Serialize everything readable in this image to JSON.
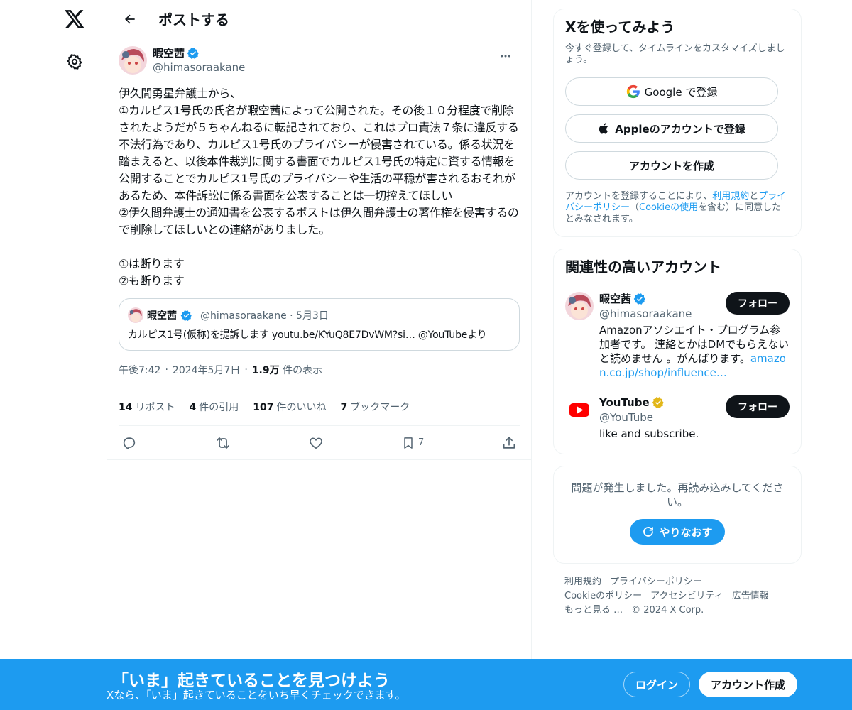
{
  "nav": {
    "logo_icon": "x-logo-icon",
    "settings_icon": "gear-icon"
  },
  "header": {
    "title": "ポストする"
  },
  "post": {
    "author_name": "暇空茜",
    "author_handle": "@himasoraakane",
    "body": "伊久間勇星弁護士から、\n①カルピス1号氏の氏名が暇空茜によって公開された。その後１０分程度で削除されたようだが５ちゃんねるに転記されており、これはプロ責法７条に違反する不法行為であり、カルピス1号氏のプライバシーが侵害されている。係る状況を踏まえると、以後本件裁判に関する書面でカルピス1号氏の特定に資する情報を公開することでカルピス1号氏のプライバシーや生活の平穏が害されるおそれがあるため、本件訴訟に係る書面を公表することは一切控えてほしい\n②伊久間弁護士の通知書を公表するポストは伊久間弁護士の著作権を侵害するので削除してほしいとの連絡がありました。\n\n①は断ります\n②も断ります",
    "quote": {
      "name": "暇空茜",
      "meta": "@himasoraakane · 5月3日",
      "text": "カルピス1号(仮称)を提訴します youtu.be/KYuQ8E7DvWM?si… @YouTubeより"
    },
    "time": "午後7:42",
    "date": "2024年5月7日",
    "views_count": "1.9万",
    "views_label": "件の表示",
    "stats": [
      {
        "count": "14",
        "label": "リポスト"
      },
      {
        "count": "4",
        "label": "件の引用"
      },
      {
        "count": "107",
        "label": "件のいいね"
      },
      {
        "count": "7",
        "label": "ブックマーク"
      }
    ],
    "bookmark_count": "7"
  },
  "signup_card": {
    "title": "Xを使ってみよう",
    "subtitle": "今すぐ登録して、タイムラインをカスタマイズしましょう。",
    "google_label": "Google で登録",
    "apple_label": "Appleのアカウントで登録",
    "create_label": "アカウントを作成",
    "legal_pre": "アカウントを登録することにより、",
    "legal_terms": "利用規約",
    "legal_and": "と",
    "legal_privacy": "プライバシーポリシー",
    "legal_mid": "（",
    "legal_cookie": "Cookieの使用",
    "legal_post": "を含む）に同意したとみなされます。"
  },
  "related": {
    "title": "関連性の高いアカウント",
    "follow_label": "フォロー",
    "accounts": [
      {
        "name": "暇空茜",
        "handle": "@himasoraakane",
        "bio": "Amazonアソシエイト・プログラム参加者です。 連絡とかはDMでもらえないと読めません 。がんばりま",
        "bio_tail": "す。",
        "bio_link": "amazon.co.jp/shop/influence…"
      },
      {
        "name": "YouTube",
        "handle": "@YouTube",
        "bio": "like and subscribe."
      }
    ]
  },
  "error_card": {
    "message": "問題が発生しました。再読み込みしてください。",
    "retry_label": "やりなおす"
  },
  "footer": {
    "links": [
      "利用規約",
      "プライバシーポリシー",
      "Cookieのポリシー",
      "アクセシビリティ",
      "広告情報",
      "もっと見る …",
      "© 2024 X Corp."
    ]
  },
  "banner": {
    "title": "「いま」起きていることを見つけよう",
    "subtitle": "Xなら、「いま」起きていることをいち早くチェックできます。",
    "login_label": "ログイン",
    "signup_label": "アカウント作成"
  },
  "colors": {
    "accent": "#1d9bf0",
    "verified": "#1d9bf0",
    "verified_gold": "#e2b719",
    "text": "#0f1419",
    "muted": "#536471"
  }
}
